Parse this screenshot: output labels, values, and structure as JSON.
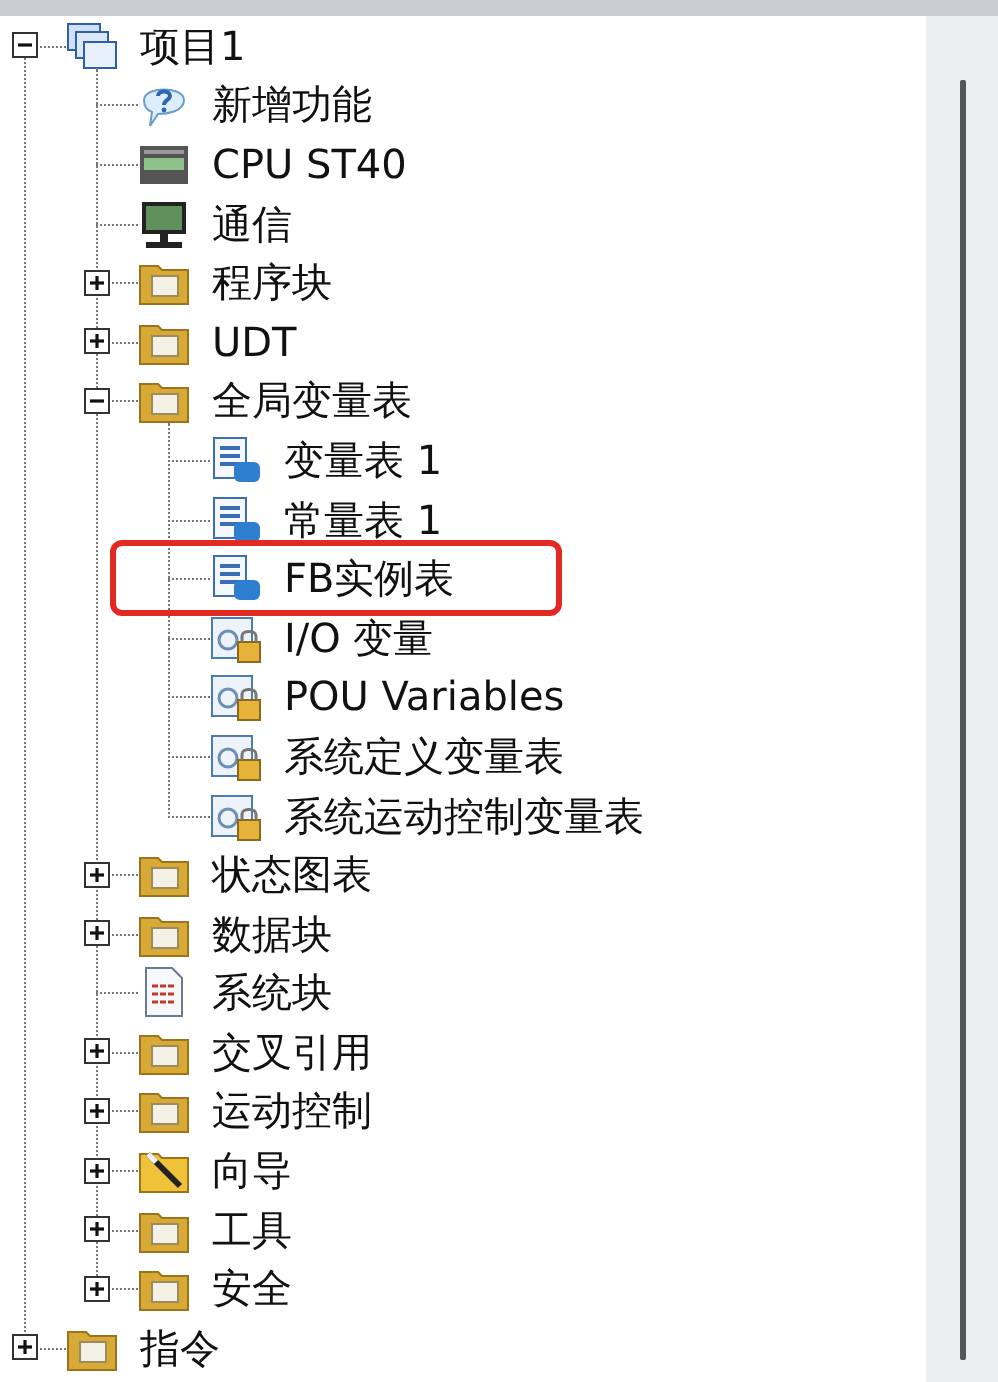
{
  "tree": [
    {
      "label": "项目1",
      "kind": "project",
      "expanded": true,
      "children": [
        {
          "label": "新增功能",
          "kind": "help"
        },
        {
          "label": "CPU ST40",
          "kind": "cpu"
        },
        {
          "label": "通信",
          "kind": "monitor"
        },
        {
          "label": "程序块",
          "kind": "folder",
          "expanded": false
        },
        {
          "label": "UDT",
          "kind": "folder",
          "expanded": false
        },
        {
          "label": "全局变量表",
          "kind": "folder",
          "expanded": true,
          "children": [
            {
              "label": "变量表 1",
              "kind": "table",
              "highlighted": false
            },
            {
              "label": "常量表 1",
              "kind": "table",
              "highlighted": false
            },
            {
              "label": "FB实例表",
              "kind": "table",
              "highlighted": true
            },
            {
              "label": "I/O 变量",
              "kind": "locked-table",
              "highlighted": false
            },
            {
              "label": "POU Variables",
              "kind": "locked-table",
              "highlighted": false
            },
            {
              "label": "系统定义变量表",
              "kind": "locked-table",
              "highlighted": false
            },
            {
              "label": "系统运动控制变量表",
              "kind": "locked-table",
              "highlighted": false
            }
          ]
        },
        {
          "label": "状态图表",
          "kind": "folder",
          "expanded": false
        },
        {
          "label": "数据块",
          "kind": "folder",
          "expanded": false
        },
        {
          "label": "系统块",
          "kind": "document"
        },
        {
          "label": "交叉引用",
          "kind": "folder",
          "expanded": false
        },
        {
          "label": "运动控制",
          "kind": "folder",
          "expanded": false
        },
        {
          "label": "向导",
          "kind": "wizard",
          "expanded": false
        },
        {
          "label": "工具",
          "kind": "folder",
          "expanded": false
        },
        {
          "label": "安全",
          "kind": "folder",
          "expanded": false
        }
      ]
    },
    {
      "label": "指令",
      "kind": "folder",
      "expanded": false
    }
  ]
}
